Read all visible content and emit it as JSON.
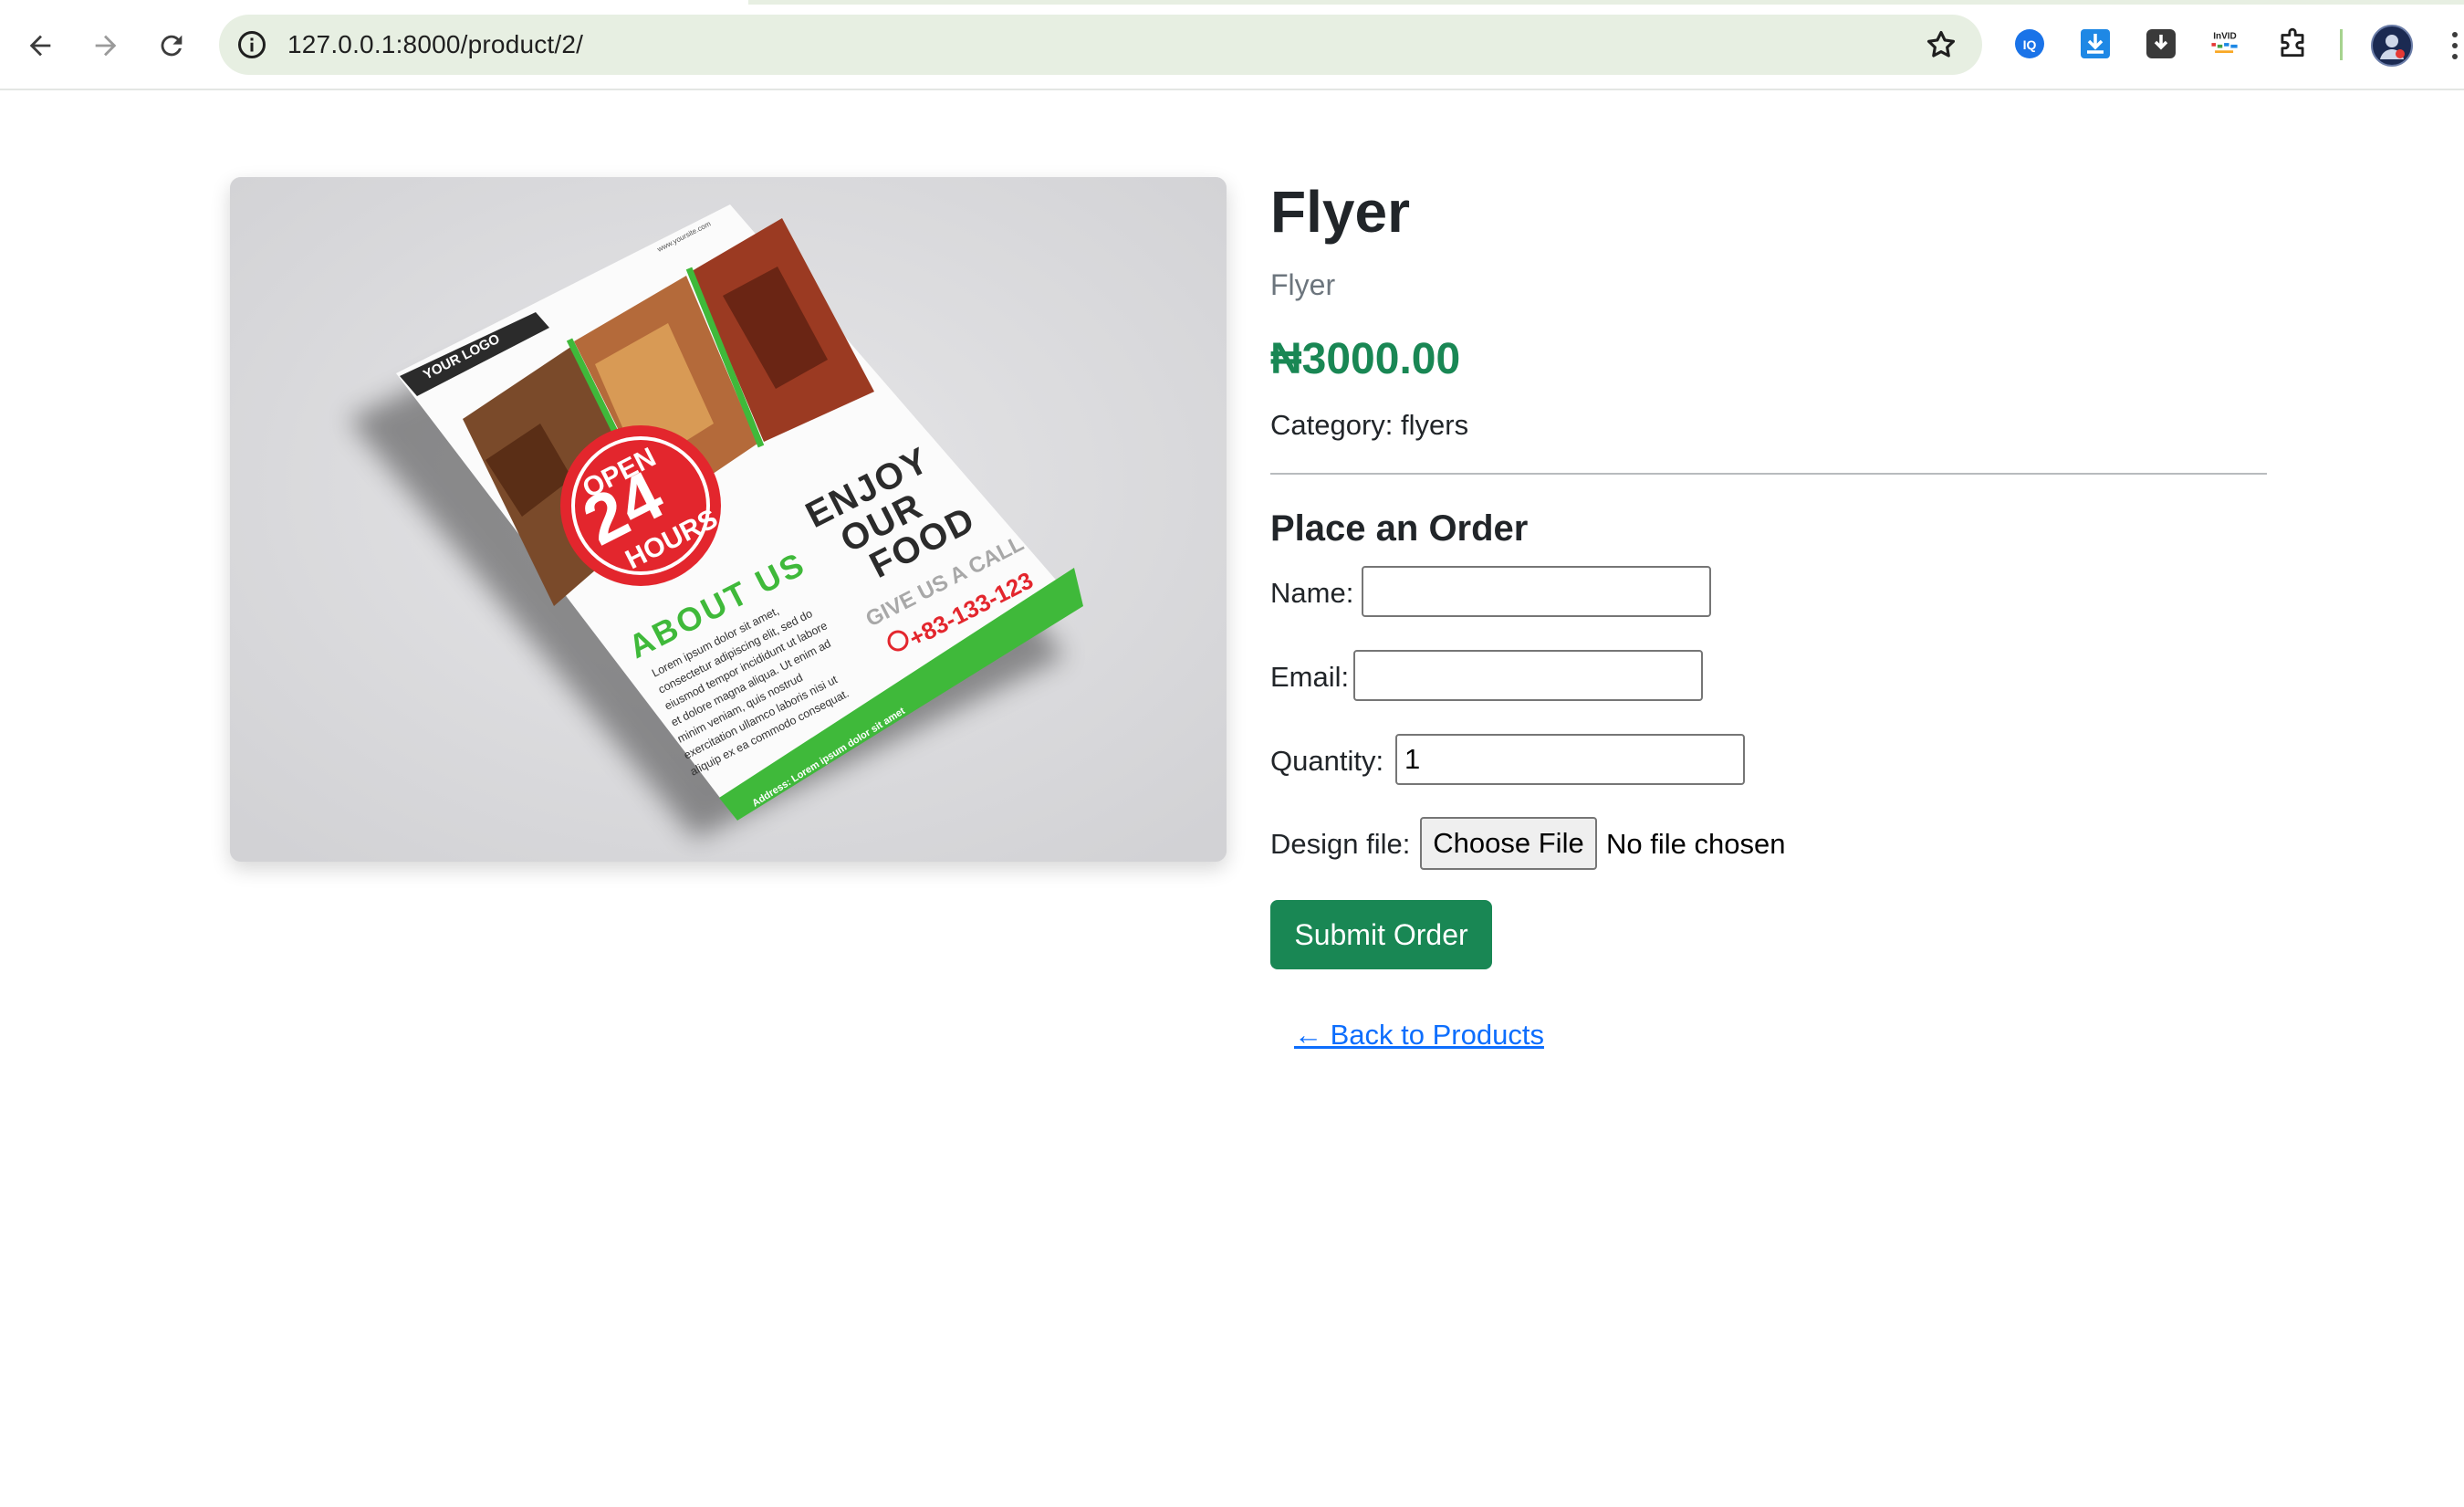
{
  "browser": {
    "url": "127.0.0.1:8000/product/2/",
    "extension_labels": [
      "InVID"
    ]
  },
  "flyer_image": {
    "texts": {
      "logo": "YOUR LOGO",
      "website": "www.yoursite.com",
      "open": "OPEN",
      "hours_number": "24",
      "hours": "HOURS",
      "enjoy": "ENJOY",
      "our": "OUR",
      "food": "FOOD",
      "about": "ABOUT US",
      "call": "GIVE US A CALL",
      "phone": "+83-133-123",
      "lorem1": "Lorem ipsum dolor sit amet,",
      "lorem2": "consectetur adipiscing elit, sed do",
      "lorem3": "eiusmod tempor incididunt ut labore",
      "lorem4": "et dolore magna aliqua. Ut enim ad",
      "lorem5": "minim veniam, quis nostrud",
      "lorem6": "exercitation ullamco laboris nisi ut",
      "lorem7": "aliquip ex ea commodo consequat.",
      "address": "Address: Lorem ipsum dolor sit amet"
    },
    "colors": {
      "green": "#3fb93a",
      "red": "#e3262d",
      "dark": "#2b2b2b"
    }
  },
  "product": {
    "title": "Flyer",
    "description": "Flyer",
    "price": "₦3000.00",
    "category": "Category: flyers"
  },
  "order_form": {
    "heading": "Place an Order",
    "name_label": "Name:",
    "name_value": "",
    "email_label": "Email:",
    "email_value": "",
    "quantity_label": "Quantity:",
    "quantity_value": "1",
    "design_label": "Design file:",
    "file_button": "Choose File",
    "file_status": "No file chosen",
    "submit_label": "Submit Order"
  },
  "back_link": "← Back to Products",
  "colors": {
    "primary_green": "#198754",
    "link_blue": "#0d6efd",
    "muted": "#6c757d"
  }
}
